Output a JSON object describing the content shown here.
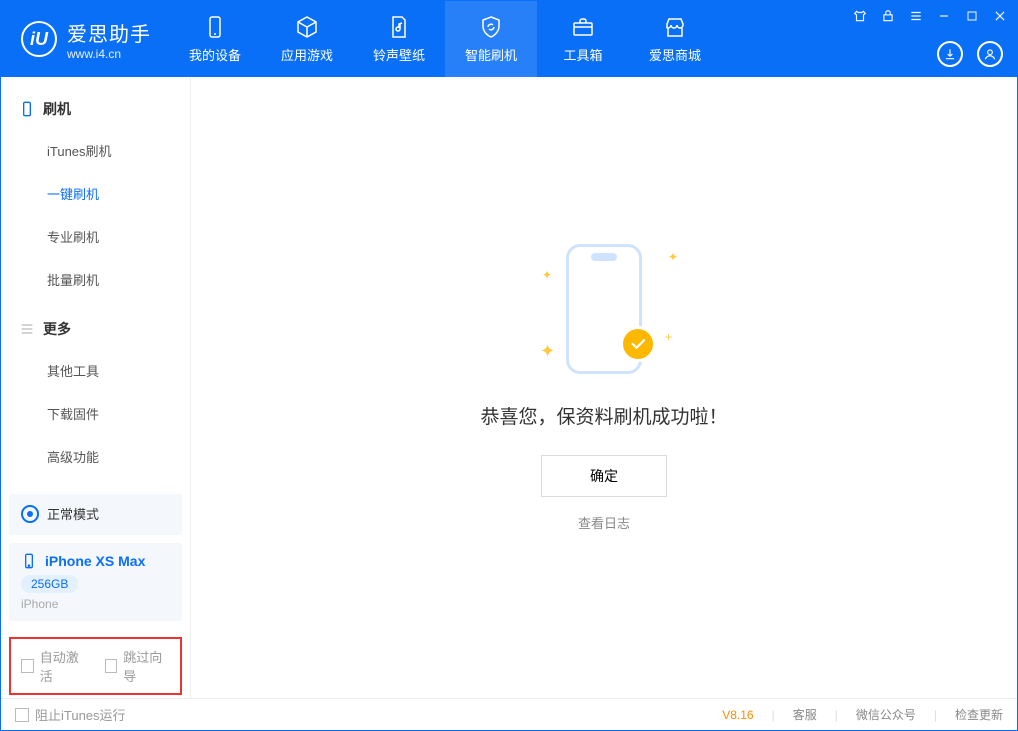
{
  "app": {
    "name": "爱思助手",
    "site": "www.i4.cn"
  },
  "nav": {
    "items": [
      {
        "label": "我的设备"
      },
      {
        "label": "应用游戏"
      },
      {
        "label": "铃声壁纸"
      },
      {
        "label": "智能刷机"
      },
      {
        "label": "工具箱"
      },
      {
        "label": "爱思商城"
      }
    ]
  },
  "sidebar": {
    "section1": {
      "title": "刷机",
      "items": [
        "iTunes刷机",
        "一键刷机",
        "专业刷机",
        "批量刷机"
      ],
      "activeIndex": 1
    },
    "section2": {
      "title": "更多",
      "items": [
        "其他工具",
        "下载固件",
        "高级功能"
      ]
    },
    "mode": {
      "label": "正常模式"
    },
    "device": {
      "name": "iPhone XS Max",
      "storage": "256GB",
      "type": "iPhone"
    },
    "checks": {
      "autoActivate": "自动激活",
      "skipGuide": "跳过向导"
    }
  },
  "content": {
    "message": "恭喜您，保资料刷机成功啦！",
    "okButton": "确定",
    "logLink": "查看日志"
  },
  "status": {
    "blockItunes": "阻止iTunes运行",
    "version": "V8.16",
    "links": [
      "客服",
      "微信公众号",
      "检查更新"
    ]
  }
}
